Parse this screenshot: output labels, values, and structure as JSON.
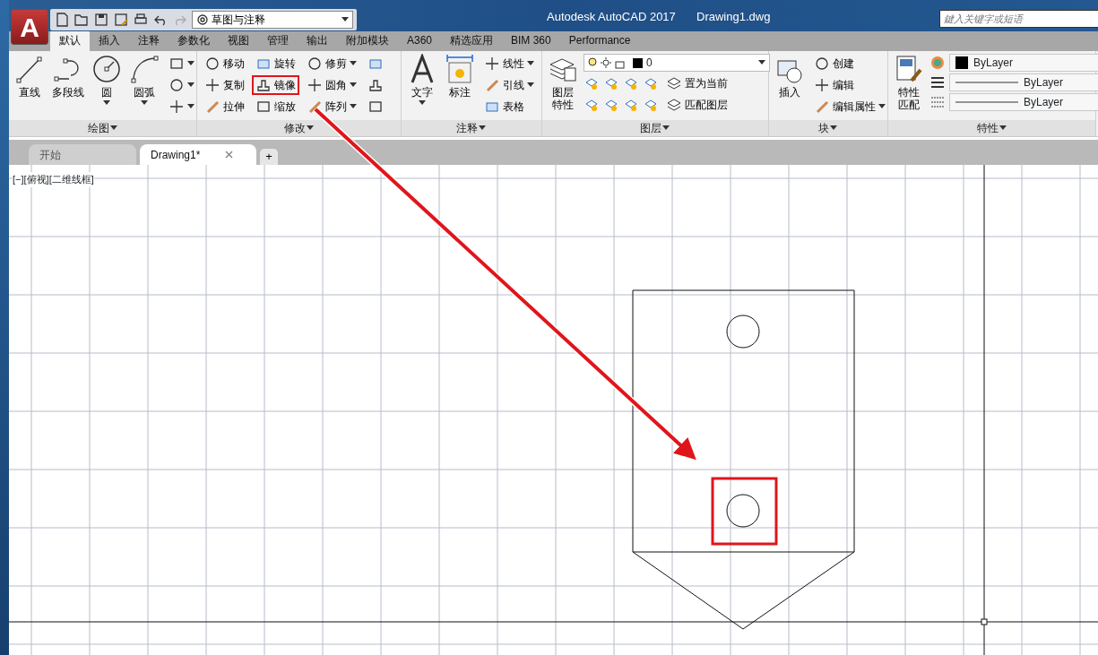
{
  "title_bar": {
    "app_button": {
      "letter": "A"
    },
    "workspace": "草图与注释",
    "app_title": "Autodesk AutoCAD 2017",
    "document": "Drawing1.dwg",
    "search": {
      "placeholder": "鍵入关键字或短语"
    }
  },
  "ribbon_tabs": [
    {
      "label": "默认",
      "selected": true
    },
    {
      "label": "插入",
      "selected": false
    },
    {
      "label": "注释",
      "selected": false
    },
    {
      "label": "参数化",
      "selected": false
    },
    {
      "label": "视图",
      "selected": false
    },
    {
      "label": "管理",
      "selected": false
    },
    {
      "label": "输出",
      "selected": false
    },
    {
      "label": "附加模块",
      "selected": false
    },
    {
      "label": "A360",
      "selected": false
    },
    {
      "label": "精选应用",
      "selected": false
    },
    {
      "label": "BIM 360",
      "selected": false
    },
    {
      "label": "Performance",
      "selected": false
    }
  ],
  "panels": [
    {
      "title": "绘图",
      "columns": [
        {
          "kind": "large",
          "label": "直线",
          "menu": false
        },
        {
          "kind": "large",
          "label": "多段线",
          "menu": false
        },
        {
          "kind": "large",
          "label": "圆",
          "menu": true
        },
        {
          "kind": "large",
          "label": "圆弧",
          "menu": true
        },
        {
          "kind": "stack",
          "items": [
            {
              "menu": true,
              "highlighted": false
            },
            {
              "menu": true,
              "highlighted": false
            },
            {
              "menu": true,
              "highlighted": false
            }
          ]
        }
      ]
    },
    {
      "title": "修改",
      "columns": [
        {
          "kind": "stack",
          "items": [
            {
              "label": "移动",
              "menu": false,
              "highlighted": false
            },
            {
              "label": "复制",
              "menu": false,
              "highlighted": false
            },
            {
              "label": "拉伸",
              "menu": false,
              "highlighted": false
            }
          ]
        },
        {
          "kind": "stack",
          "items": [
            {
              "label": "旋转",
              "menu": false,
              "highlighted": false
            },
            {
              "label": "镜像",
              "menu": false,
              "highlighted": true
            },
            {
              "label": "缩放",
              "menu": false,
              "highlighted": false
            }
          ]
        },
        {
          "kind": "stack",
          "items": [
            {
              "label": "修剪",
              "menu": true,
              "highlighted": false
            },
            {
              "label": "圆角",
              "menu": true,
              "highlighted": false
            },
            {
              "label": "阵列",
              "menu": true,
              "highlighted": false
            }
          ]
        },
        {
          "kind": "stack",
          "items": [
            {
              "menu": false,
              "highlighted": false
            },
            {
              "menu": false,
              "highlighted": false
            },
            {
              "menu": false,
              "highlighted": false
            }
          ]
        }
      ]
    },
    {
      "title": "注释",
      "columns": [
        {
          "kind": "large",
          "label": "文字",
          "menu": true
        },
        {
          "kind": "large",
          "label": "标注",
          "menu": false
        },
        {
          "kind": "stack",
          "items": [
            {
              "label": "线性",
              "menu": true,
              "highlighted": false
            },
            {
              "label": "引线",
              "menu": true,
              "highlighted": false
            },
            {
              "label": "表格",
              "menu": false,
              "highlighted": false
            }
          ]
        }
      ]
    },
    {
      "title": "图层",
      "columns": [
        {
          "kind": "large",
          "label": "图层特性",
          "menu": false
        },
        {
          "kind": "layers",
          "value": "0",
          "rows": [
            {
              "label": "置为当前"
            },
            {
              "label": "匹配图层"
            }
          ]
        }
      ]
    },
    {
      "title": "块",
      "columns": [
        {
          "kind": "large",
          "label": "插入",
          "menu": false
        },
        {
          "kind": "stack",
          "items": [
            {
              "label": "创建",
              "menu": false,
              "highlighted": false
            },
            {
              "label": "编辑",
              "menu": false,
              "highlighted": false
            },
            {
              "label": "编辑属性",
              "menu": true,
              "highlighted": false
            }
          ]
        }
      ]
    },
    {
      "title": "特性",
      "columns": [
        {
          "kind": "large",
          "label": "特性匹配",
          "menu": false
        },
        {
          "kind": "props",
          "items": [
            {
              "value": "ByLayer",
              "swatch": true
            },
            {
              "value": "ByLayer",
              "swatch": false
            },
            {
              "value": "ByLayer",
              "swatch": false
            }
          ]
        }
      ]
    }
  ],
  "file_tabs": [
    {
      "label": "开始",
      "selected": false,
      "closable": false
    },
    {
      "label": "Drawing1*",
      "selected": true,
      "closable": true
    }
  ],
  "new_tab": "+",
  "viewport_label": "[−][俯视][二维线框]"
}
